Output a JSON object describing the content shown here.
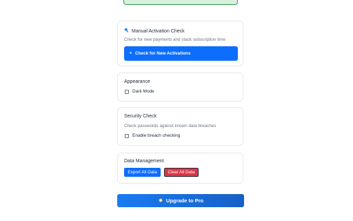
{
  "manual_activation": {
    "title": "Manual Activation Check",
    "description": "Check for new payments and stack subscription time",
    "button_label": "Check for New Activations",
    "title_icon": "magnifier-icon",
    "button_icon": "pin-icon"
  },
  "appearance": {
    "title": "Appearance",
    "dark_mode_label": "Dark Mode",
    "dark_mode_checked": false
  },
  "security": {
    "title": "Security Check",
    "description": "Check passwords against known data breaches",
    "breach_label": "Enable breach checking",
    "breach_checked": false
  },
  "data_management": {
    "title": "Data Management",
    "export_label": "Export All Data",
    "clear_label": "Clear All Data"
  },
  "upgrade": {
    "label": "Upgrade to Pro",
    "icon": "sparkle-icon"
  },
  "colors": {
    "primary": "#0d6efd",
    "danger": "#dc3545",
    "success_bg": "#d7f1dd",
    "success_border": "#2e9a4b"
  }
}
